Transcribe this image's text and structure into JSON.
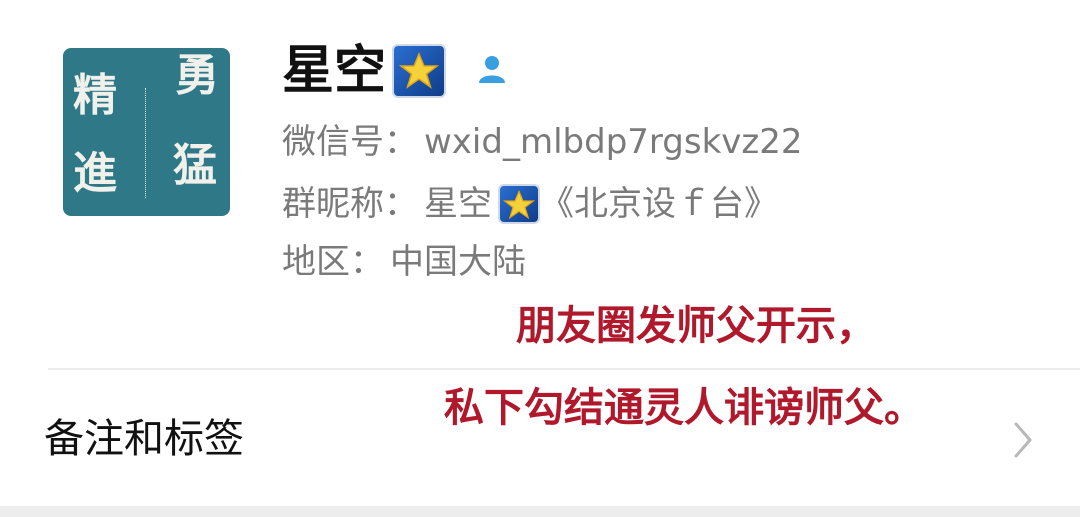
{
  "profile": {
    "avatar_text": [
      "精",
      "勇",
      "進",
      "猛"
    ],
    "name": "星空",
    "name_emoji_icon": "star-emoji-icon",
    "contact_icon": "person-icon",
    "wechat_id_label": "微信号：",
    "wechat_id": "wxid_mlbdp7rgskvz22",
    "group_nickname_label": "群昵称：",
    "group_nickname_name": "星空",
    "group_nickname_suffix": "《北京设ｆ台》",
    "region_label": "地区：",
    "region": "中国大陆"
  },
  "annotation": {
    "line1": "朋友圈发师父开示，",
    "line2": "私下勾结通灵人诽谤师父。",
    "color": "#b0182c"
  },
  "menu": {
    "remarks_tags_label": "备注和标签",
    "chevron_icon": "chevron-right-icon"
  },
  "colors": {
    "avatar_bg": "#2f7888",
    "secondary_text": "#7a7a7a"
  }
}
